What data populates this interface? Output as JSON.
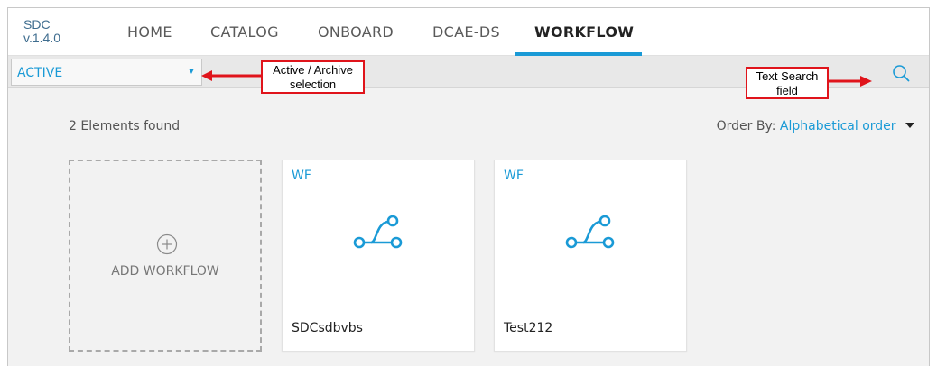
{
  "brand": {
    "name": "SDC",
    "version": "v.1.4.0"
  },
  "nav": {
    "items": [
      {
        "label": "HOME",
        "active": false
      },
      {
        "label": "CATALOG",
        "active": false
      },
      {
        "label": "ONBOARD",
        "active": false
      },
      {
        "label": "DCAE-DS",
        "active": false
      },
      {
        "label": "WORKFLOW",
        "active": true
      }
    ]
  },
  "filter": {
    "selected": "ACTIVE"
  },
  "annotations": {
    "filter_note": "Active / Archive selection",
    "search_note": "Text Search field"
  },
  "results": {
    "count_text": "2 Elements found",
    "order_label": "Order By:",
    "order_value": "Alphabetical order"
  },
  "add_card": {
    "label": "ADD WORKFLOW"
  },
  "cards": [
    {
      "type": "WF",
      "name": "SDCsdbvbs"
    },
    {
      "type": "WF",
      "name": "Test212"
    }
  ],
  "colors": {
    "accent": "#1a9ad6",
    "annotation": "#e0141b",
    "brand": "#3f6d8f"
  },
  "icons": {
    "search": "search-icon",
    "add": "plus-circle-icon",
    "workflow": "workflow-icon",
    "dropdown": "triangle-down-icon"
  }
}
